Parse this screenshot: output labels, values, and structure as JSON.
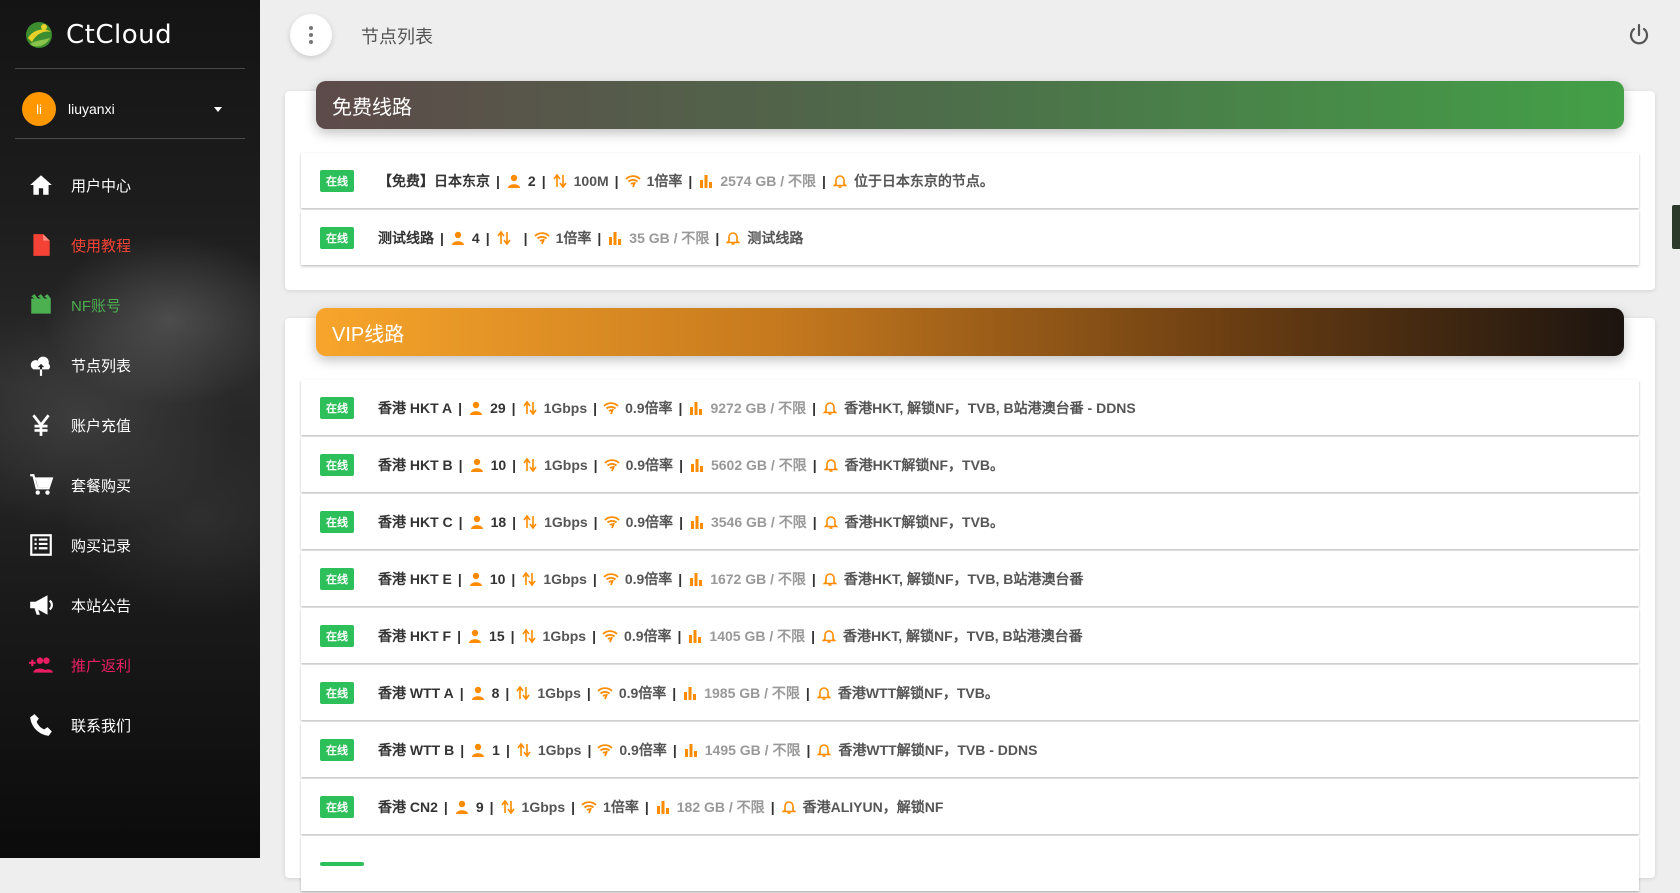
{
  "brand": {
    "name": "CtCloud"
  },
  "user": {
    "avatar_initials": "li",
    "name": "liuyanxi"
  },
  "nav": {
    "items": [
      {
        "label": "用户中心",
        "icon": "home-icon",
        "color": "#ffffff"
      },
      {
        "label": "使用教程",
        "icon": "file-icon",
        "color": "#f44336"
      },
      {
        "label": "NF账号",
        "icon": "film-icon",
        "color": "#4caf50"
      },
      {
        "label": "节点列表",
        "icon": "cloud-upload-icon",
        "color": "#ffffff"
      },
      {
        "label": "账户充值",
        "icon": "yen-icon",
        "color": "#ffffff"
      },
      {
        "label": "套餐购买",
        "icon": "cart-icon",
        "color": "#ffffff"
      },
      {
        "label": "购买记录",
        "icon": "list-icon",
        "color": "#ffffff"
      },
      {
        "label": "本站公告",
        "icon": "megaphone-icon",
        "color": "#ffffff"
      },
      {
        "label": "推广返利",
        "icon": "group-add-icon",
        "color": "#e91e63"
      },
      {
        "label": "联系我们",
        "icon": "phone-icon",
        "color": "#ffffff"
      }
    ]
  },
  "topbar": {
    "page_title": "节点列表"
  },
  "colors": {
    "accent_orange": "#ff8c00",
    "online_green": "#2dbf5a"
  },
  "sections": [
    {
      "title": "免费线路",
      "rows": [
        {
          "status": "在线",
          "name": "【免费】日本东京",
          "users": "2",
          "speed": "100M",
          "rate": "1倍率",
          "traffic": "2574 GB / 不限",
          "desc": "位于日本东京的节点。"
        },
        {
          "status": "在线",
          "name": "测试线路",
          "users": "4",
          "speed": "",
          "rate": "1倍率",
          "traffic": "35 GB / 不限",
          "desc": "测试线路"
        }
      ]
    },
    {
      "title": "VIP线路",
      "rows": [
        {
          "status": "在线",
          "name": "香港 HKT A",
          "users": "29",
          "speed": "1Gbps",
          "rate": "0.9倍率",
          "traffic": "9272 GB / 不限",
          "desc": "香港HKT, 解锁NF，TVB, B站港澳台番 - DDNS"
        },
        {
          "status": "在线",
          "name": "香港 HKT B",
          "users": "10",
          "speed": "1Gbps",
          "rate": "0.9倍率",
          "traffic": "5602 GB / 不限",
          "desc": "香港HKT解锁NF，TVB。"
        },
        {
          "status": "在线",
          "name": "香港 HKT C",
          "users": "18",
          "speed": "1Gbps",
          "rate": "0.9倍率",
          "traffic": "3546 GB / 不限",
          "desc": "香港HKT解锁NF，TVB。"
        },
        {
          "status": "在线",
          "name": "香港 HKT E",
          "users": "10",
          "speed": "1Gbps",
          "rate": "0.9倍率",
          "traffic": "1672 GB / 不限",
          "desc": "香港HKT, 解锁NF，TVB, B站港澳台番"
        },
        {
          "status": "在线",
          "name": "香港 HKT F",
          "users": "15",
          "speed": "1Gbps",
          "rate": "0.9倍率",
          "traffic": "1405 GB / 不限",
          "desc": "香港HKT, 解锁NF，TVB, B站港澳台番"
        },
        {
          "status": "在线",
          "name": "香港 WTT A",
          "users": "8",
          "speed": "1Gbps",
          "rate": "0.9倍率",
          "traffic": "1985 GB / 不限",
          "desc": "香港WTT解锁NF，TVB。"
        },
        {
          "status": "在线",
          "name": "香港 WTT B",
          "users": "1",
          "speed": "1Gbps",
          "rate": "0.9倍率",
          "traffic": "1495 GB / 不限",
          "desc": "香港WTT解锁NF，TVB - DDNS"
        },
        {
          "status": "在线",
          "name": "香港 CN2",
          "users": "9",
          "speed": "1Gbps",
          "rate": "1倍率",
          "traffic": "182 GB / 不限",
          "desc": "香港ALIYUN，解锁NF"
        }
      ]
    }
  ]
}
